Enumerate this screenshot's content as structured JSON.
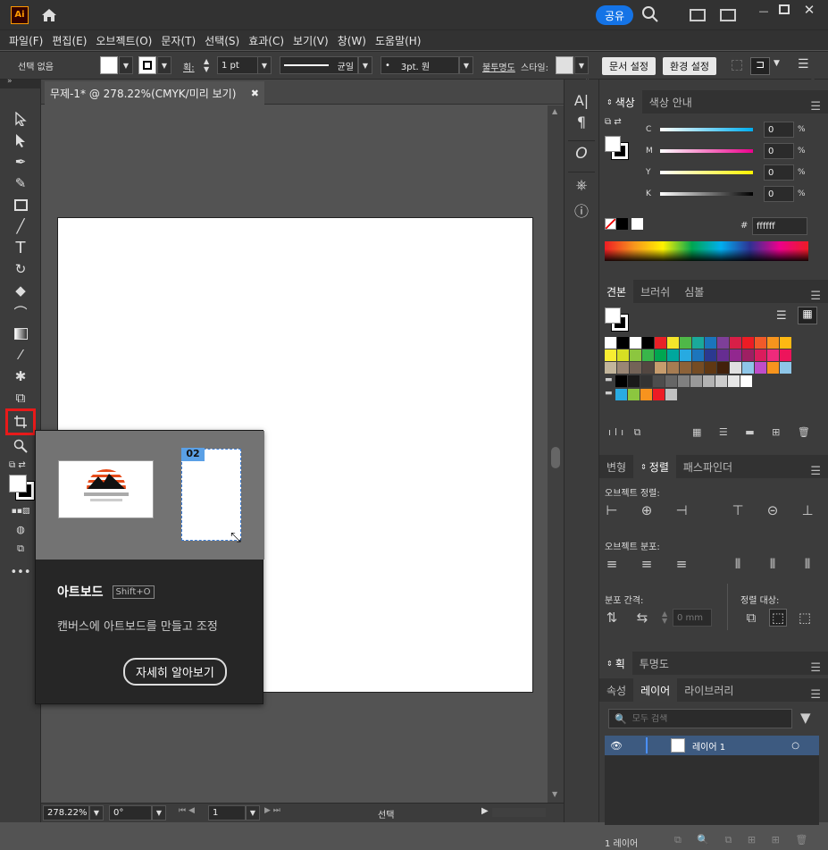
{
  "app": {
    "logo": "Ai",
    "share_label": "공유"
  },
  "menu": [
    "파일(F)",
    "편집(E)",
    "오브젝트(O)",
    "문자(T)",
    "선택(S)",
    "효과(C)",
    "보기(V)",
    "창(W)",
    "도움말(H)"
  ],
  "control": {
    "selection": "선택 없음",
    "stroke_label": "획:",
    "stroke_value": "1 pt",
    "profile": "균일",
    "brush": "3pt. 원",
    "opacity_label": "불투명도",
    "style_label": "스타일:",
    "doc_setup": "문서 설정",
    "prefs": "환경 설정"
  },
  "document": {
    "tab_title": "무제-1* @ 278.22%(CMYK/미리 보기)"
  },
  "status": {
    "zoom": "278.22%",
    "rotation": "0°",
    "artboard_index": "1",
    "mode": "선택"
  },
  "tooltip": {
    "name": "아트보드",
    "shortcut": "Shift+O",
    "description": "캔버스에 아트보드를 만들고 조정",
    "learn_more": "자세히 알아보기",
    "artboard_num": "02"
  },
  "color_panel": {
    "tabs": [
      "색상",
      "색상 안내"
    ],
    "channels": [
      {
        "label": "C",
        "value": "0",
        "unit": "%"
      },
      {
        "label": "M",
        "value": "0",
        "unit": "%"
      },
      {
        "label": "Y",
        "value": "0",
        "unit": "%"
      },
      {
        "label": "K",
        "value": "0",
        "unit": "%"
      }
    ],
    "hex": "ffffff",
    "hash": "#"
  },
  "swatches_panel": {
    "tabs": [
      "견본",
      "브러쉬",
      "심볼"
    ],
    "row1": [
      "#ffffff",
      "#000000",
      "#ffffff",
      "#000000",
      "#e82127",
      "#f5e52a",
      "#4fb848",
      "#1aa99b",
      "#1b75bc",
      "#7e3f98",
      "#d71f47",
      "#ed1c24",
      "#f15a29",
      "#f7941d",
      "#fdb813"
    ],
    "row2": [
      "#f9ed32",
      "#d7df23",
      "#8cc63f",
      "#39b54a",
      "#00a651",
      "#00a79d",
      "#27aae1",
      "#1c75bc",
      "#2b3990",
      "#662d91",
      "#92278f",
      "#9e1f63",
      "#da1c5c",
      "#ee2a7b",
      "#ed145b"
    ],
    "row3": [
      "#c2b59b",
      "#998675",
      "#736357",
      "#534741",
      "#c69c6d",
      "#a67c52",
      "#8c6239",
      "#754c24",
      "#603813",
      "#42210b",
      "#e0e0e0",
      "#8ec6e8",
      "#c04dc9",
      "#f7941d",
      "#8ec6e8"
    ],
    "grays": [
      "#000000",
      "#1a1a1a",
      "#333333",
      "#4d4d4d",
      "#666666",
      "#808080",
      "#999999",
      "#b3b3b3",
      "#cccccc",
      "#e6e6e6",
      "#ffffff"
    ],
    "colorgroup": [
      "#29abe2",
      "#8cc63f",
      "#f7931e",
      "#ed1c24",
      "#c1c1c1"
    ]
  },
  "align_panel": {
    "tabs": [
      "변형",
      "정렬",
      "패스파인더"
    ],
    "align_objects": "오브젝트 정렬:",
    "distribute_objects": "오브젝트 분포:",
    "distribute_spacing": "분포 간격:",
    "align_to": "정렬 대상:",
    "spacing_value": "0 mm"
  },
  "stroke_panel": {
    "tabs": [
      "획",
      "투명도"
    ]
  },
  "layers_panel": {
    "tabs": [
      "속성",
      "레이어",
      "라이브러리"
    ],
    "search_placeholder": "모두 검색",
    "layer_name": "레이어 1",
    "count": "1 레이어"
  }
}
